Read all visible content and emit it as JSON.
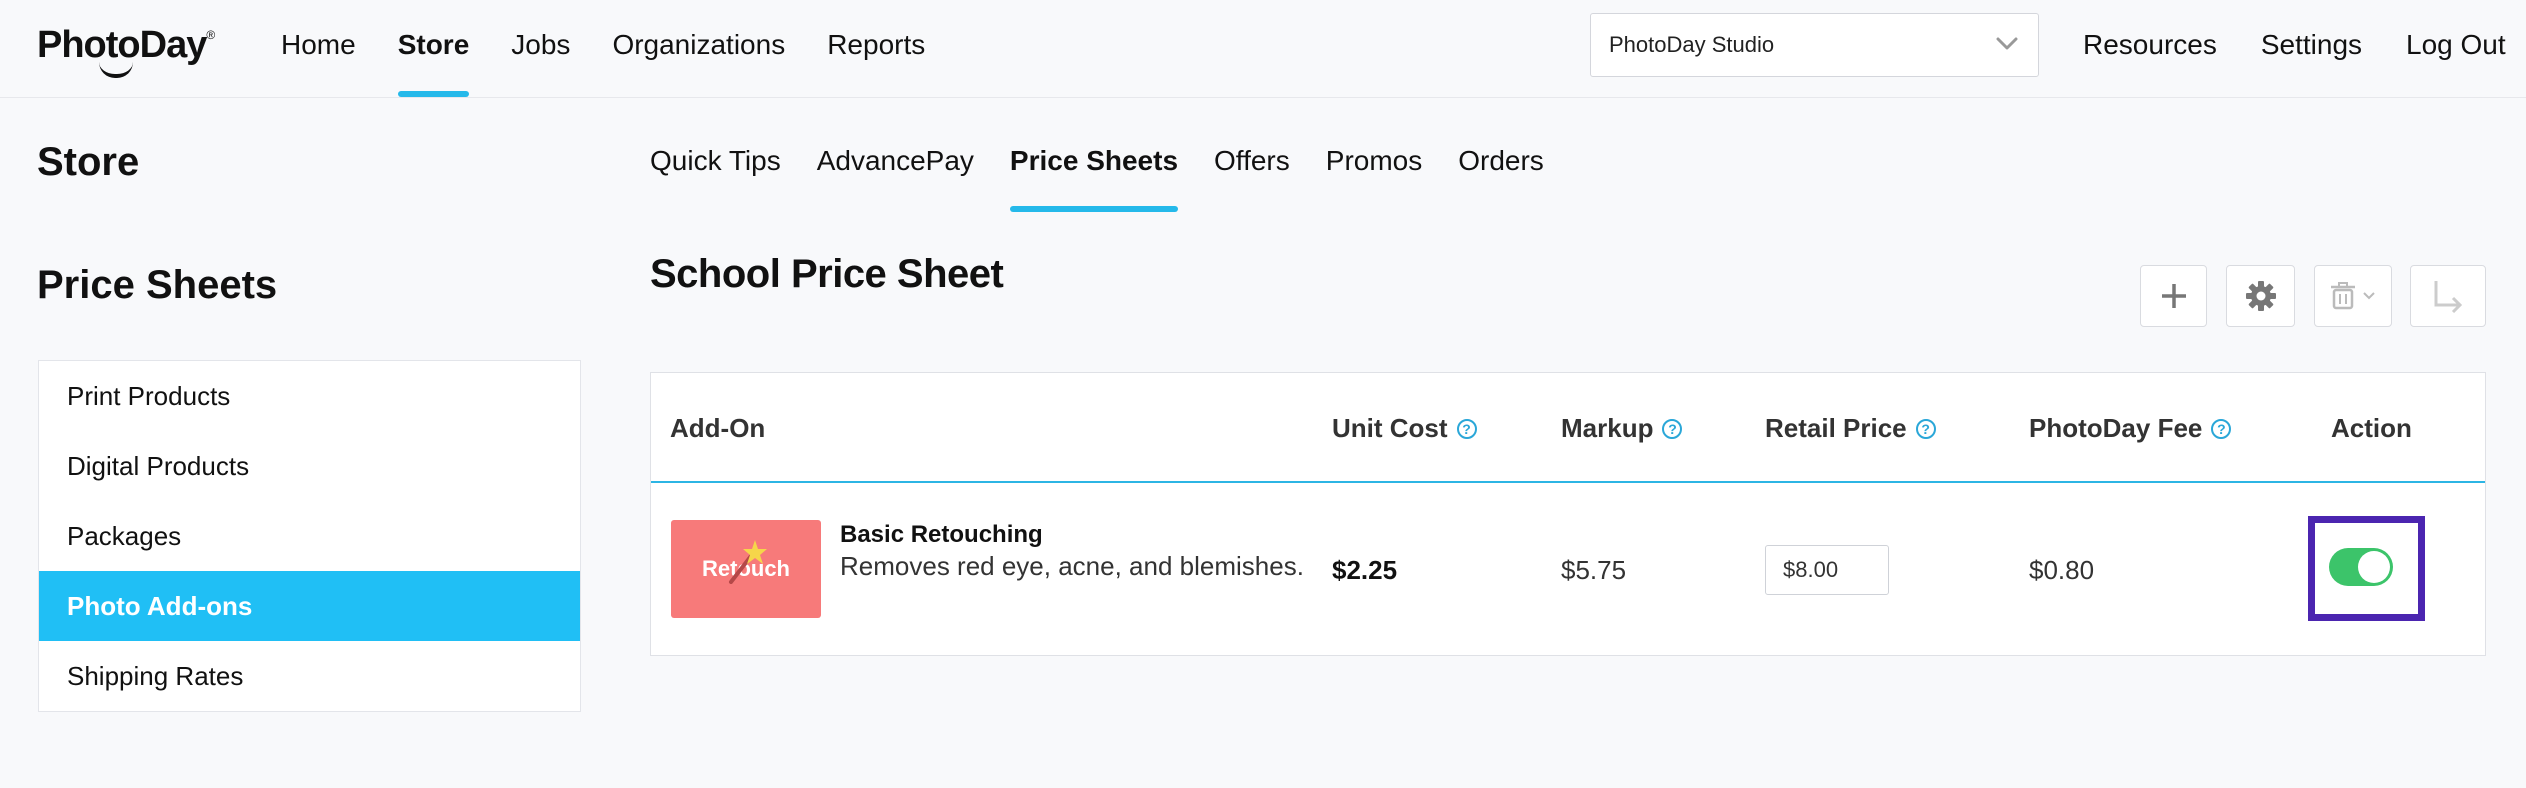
{
  "brand": {
    "logo_text": "PhotoDay",
    "accent_color": "#25b9ea"
  },
  "main_nav": {
    "items": [
      "Home",
      "Store",
      "Jobs",
      "Organizations",
      "Reports"
    ],
    "active": "Store"
  },
  "studio_select": {
    "value": "PhotoDay Studio",
    "icon": "chevron-down-icon"
  },
  "right_nav": {
    "items": [
      "Resources",
      "Settings",
      "Log Out"
    ]
  },
  "page": {
    "section_title": "Store",
    "sidebar_title": "Price Sheets"
  },
  "sidebar": {
    "items": [
      "Print Products",
      "Digital Products",
      "Packages",
      "Photo Add-ons",
      "Shipping Rates"
    ],
    "active": "Photo Add-ons",
    "active_color": "#20bff5"
  },
  "sub_nav": {
    "tabs": [
      "Quick Tips",
      "AdvancePay",
      "Price Sheets",
      "Offers",
      "Promos",
      "Orders"
    ],
    "active": "Price Sheets"
  },
  "sheet": {
    "title": "School Price Sheet"
  },
  "toolbar": {
    "buttons": [
      "plus-icon",
      "gear-icon",
      "trash-icon",
      "arrow-turn-icon"
    ]
  },
  "table": {
    "columns": [
      "Add-On",
      "Unit Cost",
      "Markup",
      "Retail Price",
      "PhotoDay Fee",
      "Action"
    ],
    "help_icon": "?",
    "rows": [
      {
        "thumbnail_label": "Retouch",
        "name": "Basic Retouching",
        "description": "Removes red eye, acne, and blemishes.",
        "unit_cost": "$2.25",
        "markup": "$5.75",
        "retail_price": "$8.00",
        "photoday_fee": "$0.80",
        "enabled": true
      }
    ]
  },
  "colors": {
    "toggle_on": "#3cc46a",
    "highlight": "#4b25b0",
    "thumbnail_bg": "#f77a7a"
  }
}
